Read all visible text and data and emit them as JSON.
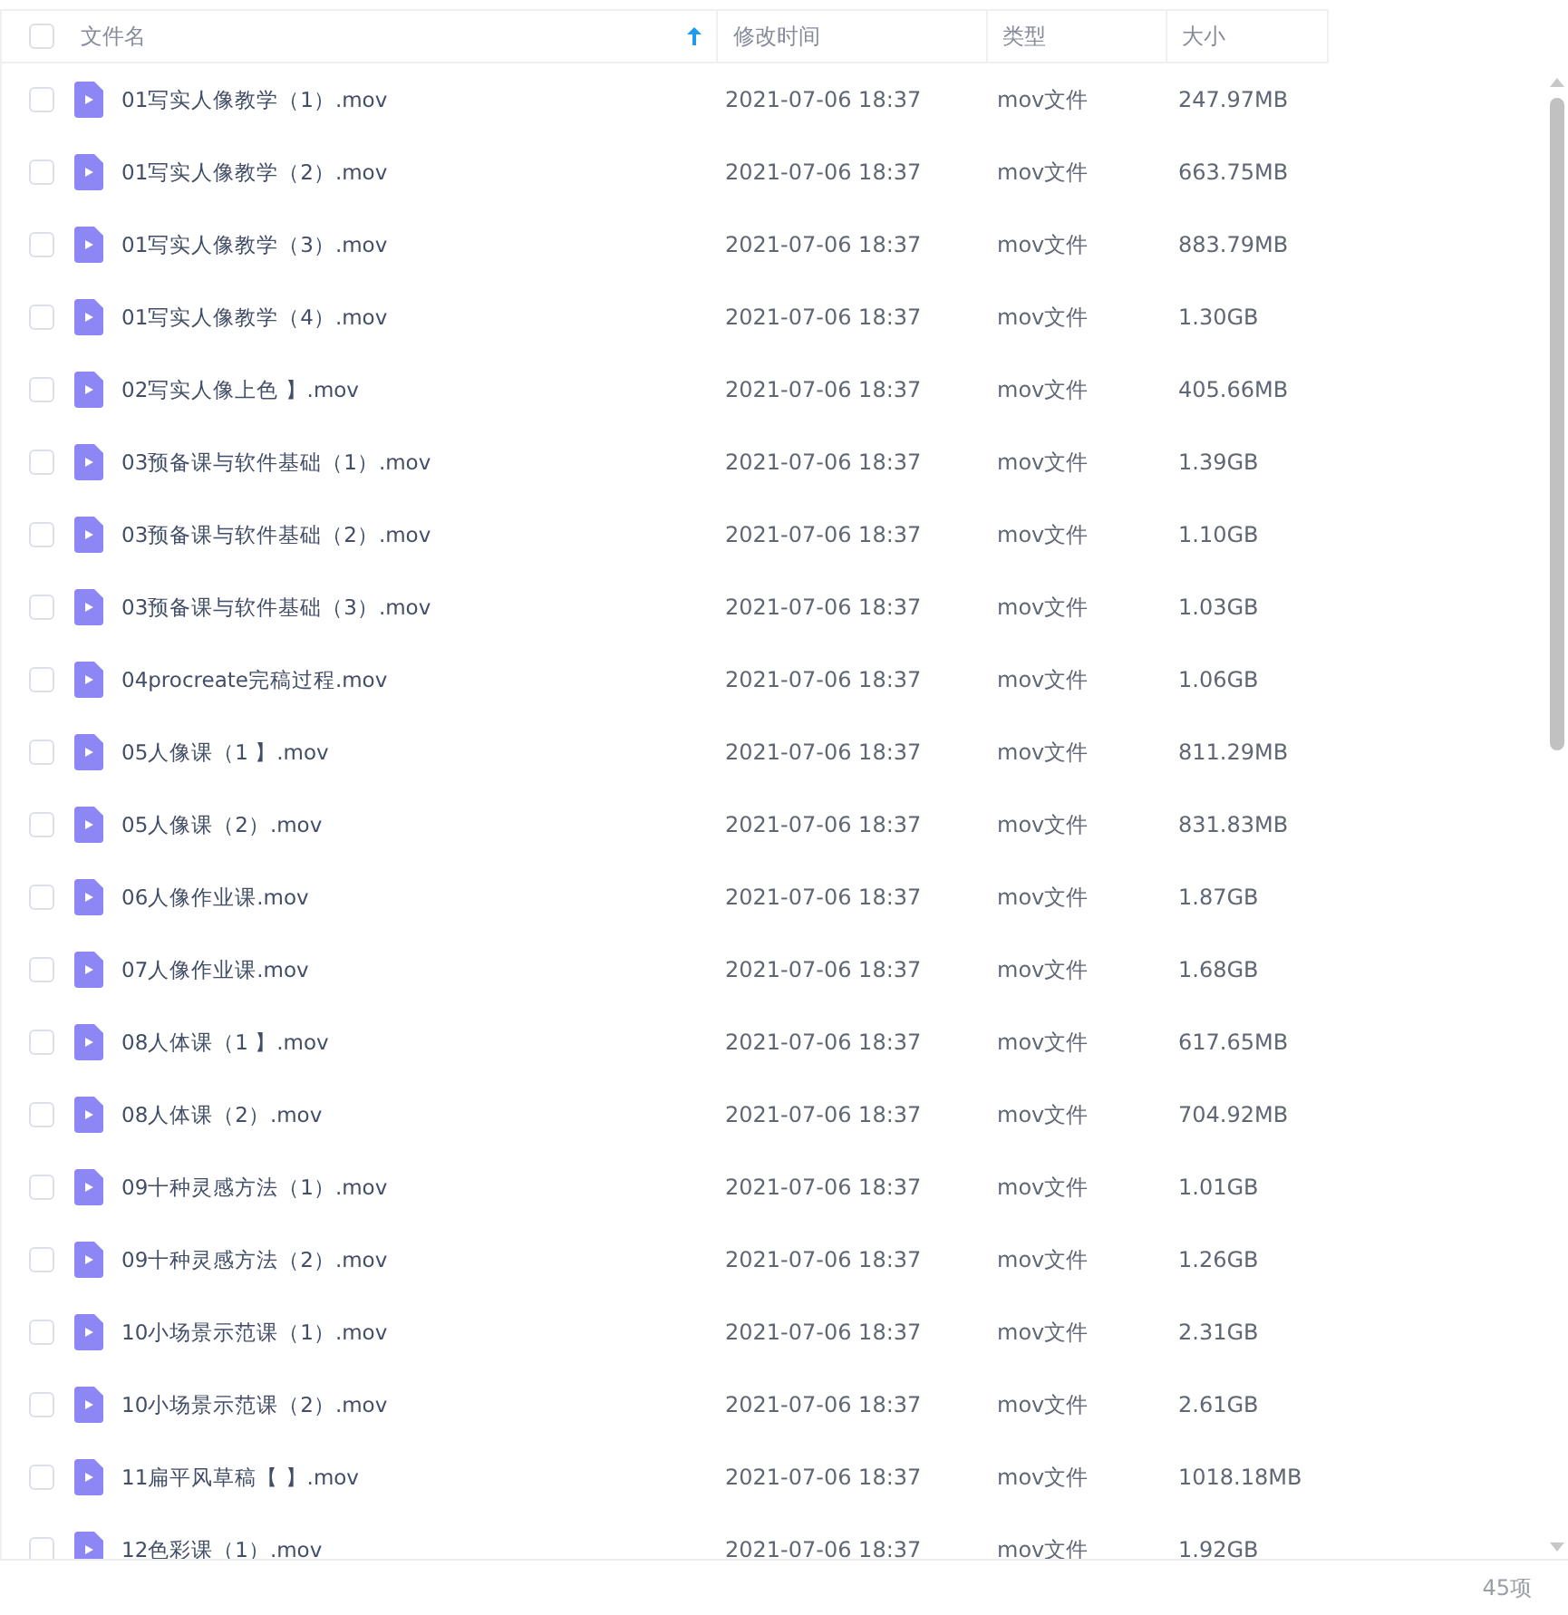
{
  "table": {
    "select_all": {
      "checked": false
    },
    "columns": [
      {
        "label": "文件名",
        "sorted": true
      },
      {
        "label": "修改时间",
        "sorted": false
      },
      {
        "label": "类型",
        "sorted": false
      },
      {
        "label": "大小",
        "sorted": false
      }
    ],
    "rows": [
      {
        "name": "01写实人像教学（1）.mov",
        "modified": "2021-07-06 18:37",
        "type": "mov文件",
        "size": "247.97MB",
        "checked": false
      },
      {
        "name": "01写实人像教学（2）.mov",
        "modified": "2021-07-06 18:37",
        "type": "mov文件",
        "size": "663.75MB",
        "checked": false
      },
      {
        "name": "01写实人像教学（3）.mov",
        "modified": "2021-07-06 18:37",
        "type": "mov文件",
        "size": "883.79MB",
        "checked": false
      },
      {
        "name": "01写实人像教学（4）.mov",
        "modified": "2021-07-06 18:37",
        "type": "mov文件",
        "size": "1.30GB",
        "checked": false
      },
      {
        "name": "02写实人像上色 】.mov",
        "modified": "2021-07-06 18:37",
        "type": "mov文件",
        "size": "405.66MB",
        "checked": false
      },
      {
        "name": "03预备课与软件基础（1）.mov",
        "modified": "2021-07-06 18:37",
        "type": "mov文件",
        "size": "1.39GB",
        "checked": false
      },
      {
        "name": "03预备课与软件基础（2）.mov",
        "modified": "2021-07-06 18:37",
        "type": "mov文件",
        "size": "1.10GB",
        "checked": false
      },
      {
        "name": "03预备课与软件基础（3）.mov",
        "modified": "2021-07-06 18:37",
        "type": "mov文件",
        "size": "1.03GB",
        "checked": false
      },
      {
        "name": "04procreate完稿过程.mov",
        "modified": "2021-07-06 18:37",
        "type": "mov文件",
        "size": "1.06GB",
        "checked": false
      },
      {
        "name": "05人像课（1 】.mov",
        "modified": "2021-07-06 18:37",
        "type": "mov文件",
        "size": "811.29MB",
        "checked": false
      },
      {
        "name": "05人像课（2）.mov",
        "modified": "2021-07-06 18:37",
        "type": "mov文件",
        "size": "831.83MB",
        "checked": false
      },
      {
        "name": "06人像作业课.mov",
        "modified": "2021-07-06 18:37",
        "type": "mov文件",
        "size": "1.87GB",
        "checked": false
      },
      {
        "name": "07人像作业课.mov",
        "modified": "2021-07-06 18:37",
        "type": "mov文件",
        "size": "1.68GB",
        "checked": false
      },
      {
        "name": "08人体课（1 】.mov",
        "modified": "2021-07-06 18:37",
        "type": "mov文件",
        "size": "617.65MB",
        "checked": false
      },
      {
        "name": "08人体课（2）.mov",
        "modified": "2021-07-06 18:37",
        "type": "mov文件",
        "size": "704.92MB",
        "checked": false
      },
      {
        "name": "09十种灵感方法（1）.mov",
        "modified": "2021-07-06 18:37",
        "type": "mov文件",
        "size": "1.01GB",
        "checked": false
      },
      {
        "name": "09十种灵感方法（2）.mov",
        "modified": "2021-07-06 18:37",
        "type": "mov文件",
        "size": "1.26GB",
        "checked": false
      },
      {
        "name": "10小场景示范课（1）.mov",
        "modified": "2021-07-06 18:37",
        "type": "mov文件",
        "size": "2.31GB",
        "checked": false
      },
      {
        "name": "10小场景示范课（2）.mov",
        "modified": "2021-07-06 18:37",
        "type": "mov文件",
        "size": "2.61GB",
        "checked": false
      },
      {
        "name": "11扁平风草稿【 】.mov",
        "modified": "2021-07-06 18:37",
        "type": "mov文件",
        "size": "1018.18MB",
        "checked": false
      },
      {
        "name": "12色彩课（1）.mov",
        "modified": "2021-07-06 18:37",
        "type": "mov文件",
        "size": "1.92GB",
        "checked": false
      }
    ]
  },
  "status_bar": {
    "count": "45项"
  }
}
